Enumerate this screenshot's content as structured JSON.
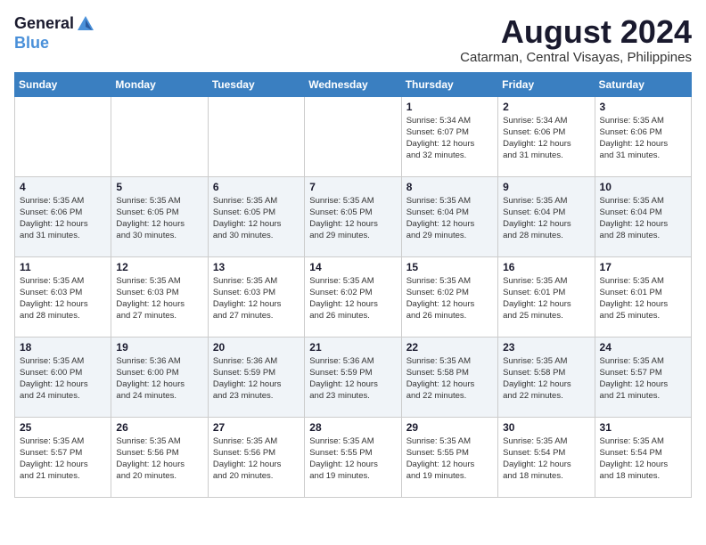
{
  "header": {
    "logo_general": "General",
    "logo_blue": "Blue",
    "title": "August 2024",
    "subtitle": "Catarman, Central Visayas, Philippines"
  },
  "weekdays": [
    "Sunday",
    "Monday",
    "Tuesday",
    "Wednesday",
    "Thursday",
    "Friday",
    "Saturday"
  ],
  "weeks": [
    [
      {
        "day": "",
        "info": ""
      },
      {
        "day": "",
        "info": ""
      },
      {
        "day": "",
        "info": ""
      },
      {
        "day": "",
        "info": ""
      },
      {
        "day": "1",
        "info": "Sunrise: 5:34 AM\nSunset: 6:07 PM\nDaylight: 12 hours\nand 32 minutes."
      },
      {
        "day": "2",
        "info": "Sunrise: 5:34 AM\nSunset: 6:06 PM\nDaylight: 12 hours\nand 31 minutes."
      },
      {
        "day": "3",
        "info": "Sunrise: 5:35 AM\nSunset: 6:06 PM\nDaylight: 12 hours\nand 31 minutes."
      }
    ],
    [
      {
        "day": "4",
        "info": "Sunrise: 5:35 AM\nSunset: 6:06 PM\nDaylight: 12 hours\nand 31 minutes."
      },
      {
        "day": "5",
        "info": "Sunrise: 5:35 AM\nSunset: 6:05 PM\nDaylight: 12 hours\nand 30 minutes."
      },
      {
        "day": "6",
        "info": "Sunrise: 5:35 AM\nSunset: 6:05 PM\nDaylight: 12 hours\nand 30 minutes."
      },
      {
        "day": "7",
        "info": "Sunrise: 5:35 AM\nSunset: 6:05 PM\nDaylight: 12 hours\nand 29 minutes."
      },
      {
        "day": "8",
        "info": "Sunrise: 5:35 AM\nSunset: 6:04 PM\nDaylight: 12 hours\nand 29 minutes."
      },
      {
        "day": "9",
        "info": "Sunrise: 5:35 AM\nSunset: 6:04 PM\nDaylight: 12 hours\nand 28 minutes."
      },
      {
        "day": "10",
        "info": "Sunrise: 5:35 AM\nSunset: 6:04 PM\nDaylight: 12 hours\nand 28 minutes."
      }
    ],
    [
      {
        "day": "11",
        "info": "Sunrise: 5:35 AM\nSunset: 6:03 PM\nDaylight: 12 hours\nand 28 minutes."
      },
      {
        "day": "12",
        "info": "Sunrise: 5:35 AM\nSunset: 6:03 PM\nDaylight: 12 hours\nand 27 minutes."
      },
      {
        "day": "13",
        "info": "Sunrise: 5:35 AM\nSunset: 6:03 PM\nDaylight: 12 hours\nand 27 minutes."
      },
      {
        "day": "14",
        "info": "Sunrise: 5:35 AM\nSunset: 6:02 PM\nDaylight: 12 hours\nand 26 minutes."
      },
      {
        "day": "15",
        "info": "Sunrise: 5:35 AM\nSunset: 6:02 PM\nDaylight: 12 hours\nand 26 minutes."
      },
      {
        "day": "16",
        "info": "Sunrise: 5:35 AM\nSunset: 6:01 PM\nDaylight: 12 hours\nand 25 minutes."
      },
      {
        "day": "17",
        "info": "Sunrise: 5:35 AM\nSunset: 6:01 PM\nDaylight: 12 hours\nand 25 minutes."
      }
    ],
    [
      {
        "day": "18",
        "info": "Sunrise: 5:35 AM\nSunset: 6:00 PM\nDaylight: 12 hours\nand 24 minutes."
      },
      {
        "day": "19",
        "info": "Sunrise: 5:36 AM\nSunset: 6:00 PM\nDaylight: 12 hours\nand 24 minutes."
      },
      {
        "day": "20",
        "info": "Sunrise: 5:36 AM\nSunset: 5:59 PM\nDaylight: 12 hours\nand 23 minutes."
      },
      {
        "day": "21",
        "info": "Sunrise: 5:36 AM\nSunset: 5:59 PM\nDaylight: 12 hours\nand 23 minutes."
      },
      {
        "day": "22",
        "info": "Sunrise: 5:35 AM\nSunset: 5:58 PM\nDaylight: 12 hours\nand 22 minutes."
      },
      {
        "day": "23",
        "info": "Sunrise: 5:35 AM\nSunset: 5:58 PM\nDaylight: 12 hours\nand 22 minutes."
      },
      {
        "day": "24",
        "info": "Sunrise: 5:35 AM\nSunset: 5:57 PM\nDaylight: 12 hours\nand 21 minutes."
      }
    ],
    [
      {
        "day": "25",
        "info": "Sunrise: 5:35 AM\nSunset: 5:57 PM\nDaylight: 12 hours\nand 21 minutes."
      },
      {
        "day": "26",
        "info": "Sunrise: 5:35 AM\nSunset: 5:56 PM\nDaylight: 12 hours\nand 20 minutes."
      },
      {
        "day": "27",
        "info": "Sunrise: 5:35 AM\nSunset: 5:56 PM\nDaylight: 12 hours\nand 20 minutes."
      },
      {
        "day": "28",
        "info": "Sunrise: 5:35 AM\nSunset: 5:55 PM\nDaylight: 12 hours\nand 19 minutes."
      },
      {
        "day": "29",
        "info": "Sunrise: 5:35 AM\nSunset: 5:55 PM\nDaylight: 12 hours\nand 19 minutes."
      },
      {
        "day": "30",
        "info": "Sunrise: 5:35 AM\nSunset: 5:54 PM\nDaylight: 12 hours\nand 18 minutes."
      },
      {
        "day": "31",
        "info": "Sunrise: 5:35 AM\nSunset: 5:54 PM\nDaylight: 12 hours\nand 18 minutes."
      }
    ]
  ]
}
